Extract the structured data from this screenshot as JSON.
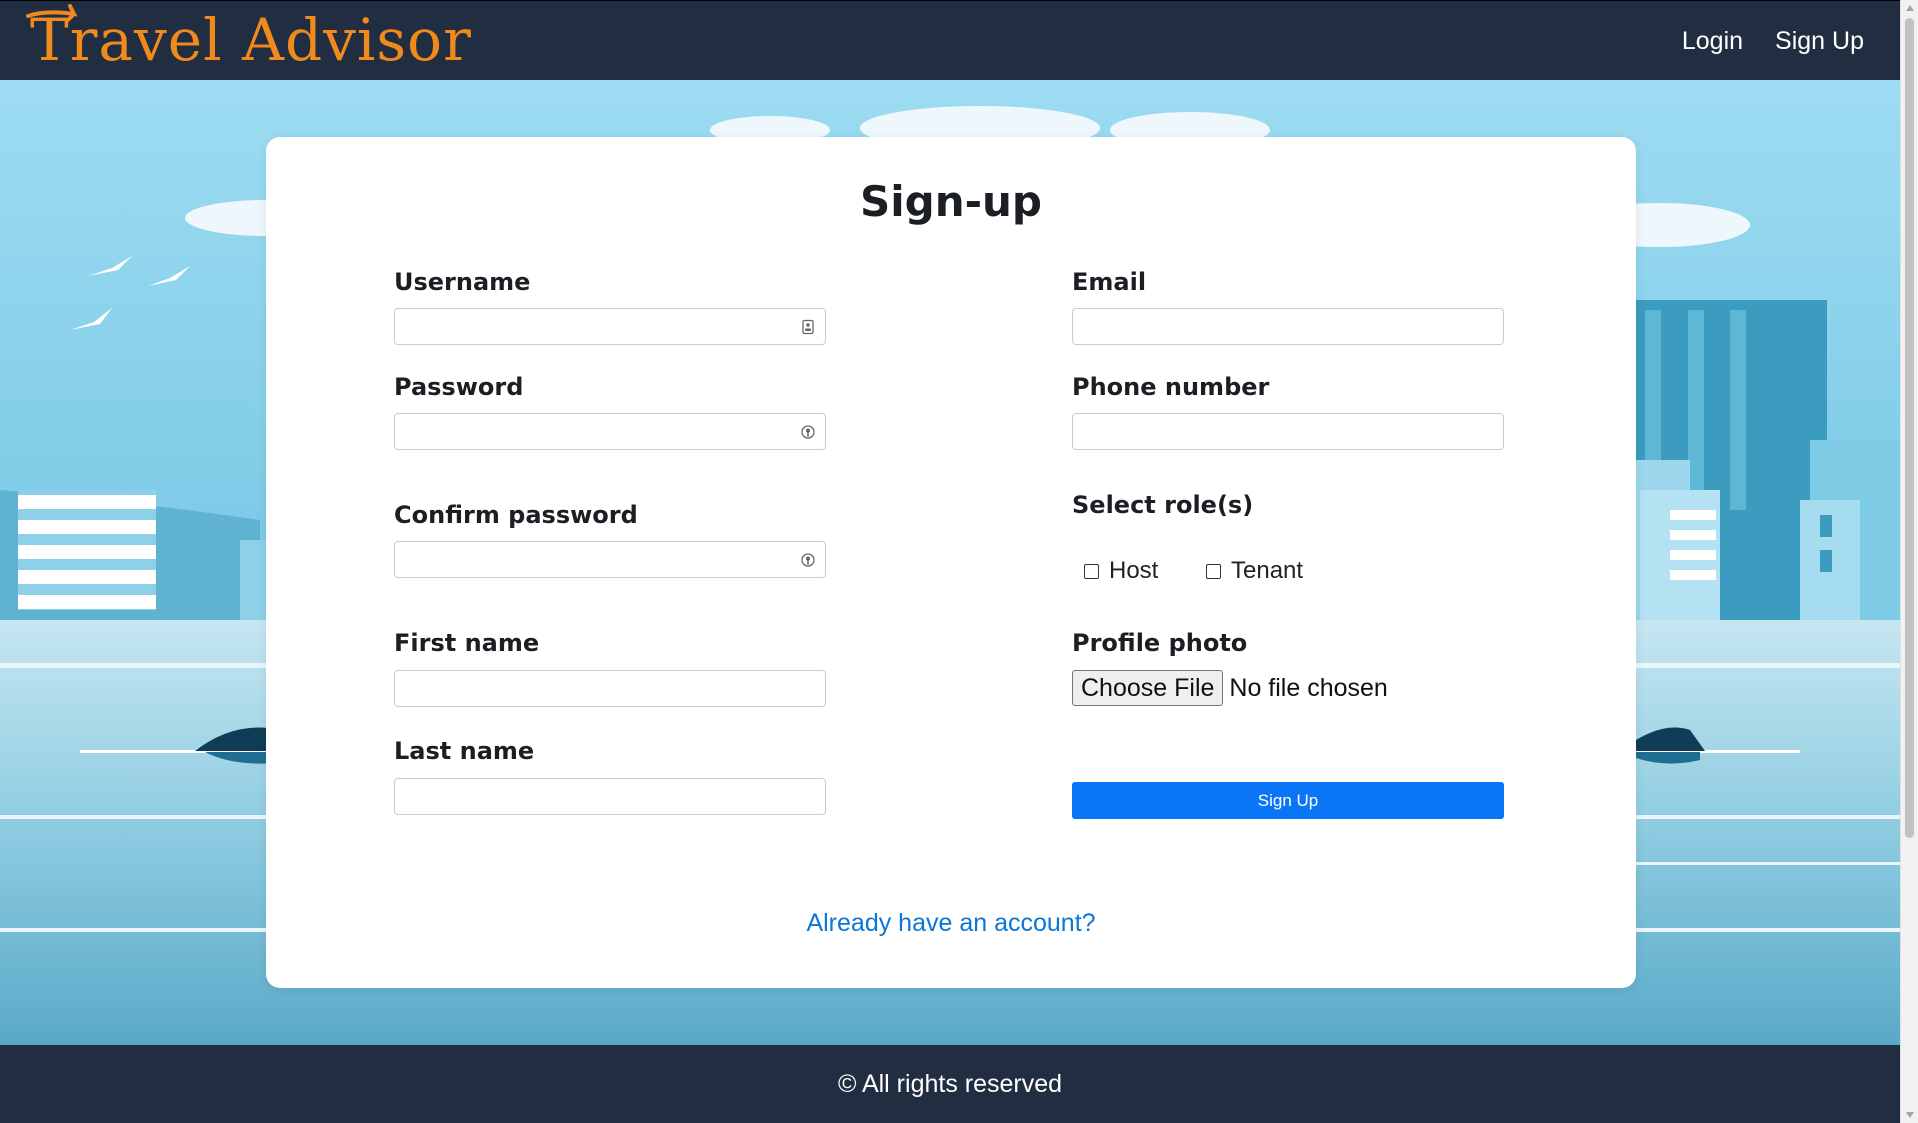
{
  "navbar": {
    "brand_first_letter": "T",
    "brand_rest": "ravel Advisor",
    "login_label": "Login",
    "signup_label": "Sign Up"
  },
  "form": {
    "title": "Sign-up",
    "username_label": "Username",
    "password_label": "Password",
    "confirm_password_label": "Confirm password",
    "first_name_label": "First name",
    "last_name_label": "Last name",
    "email_label": "Email",
    "phone_label": "Phone number",
    "roles_label": "Select role(s)",
    "roles": [
      "Host",
      "Tenant"
    ],
    "profile_photo_label": "Profile photo",
    "file_button_label": "Choose File",
    "file_status": "No file chosen",
    "submit_label": "Sign Up",
    "already_account_link": "Already have an account?"
  },
  "footer": {
    "text": "© All rights reserved"
  },
  "colors": {
    "navbar_bg": "#212e42",
    "brand": "#f08a1c",
    "primary_button": "#0a76f6",
    "link": "#0a76d6",
    "sky": "#7fcde8"
  },
  "icons": {
    "username_field_icon": "contact-card-icon",
    "password_field_icon": "key-icon",
    "confirm_password_field_icon": "key-icon"
  }
}
